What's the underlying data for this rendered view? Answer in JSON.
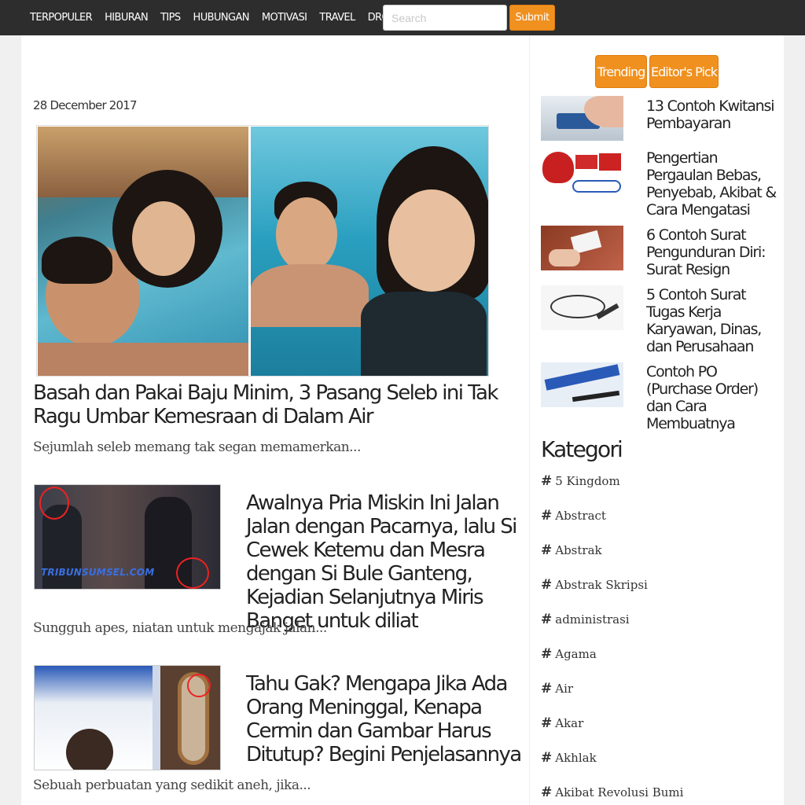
{
  "nav": {
    "items": [
      "TERPOPULER",
      "HIBURAN",
      "TIPS",
      "HUBUNGAN",
      "MOTIVASI",
      "TRAVEL",
      "DROPDOWN"
    ],
    "search_placeholder": "Search",
    "submit_label": "Submit",
    "caret_icon": "caret-down-icon"
  },
  "main": {
    "date": "28 December 2017",
    "hero": {
      "title": "Basah dan Pakai Baju Minim, 3 Pasang Seleb ini Tak Ragu Umbar Kemesraan di Dalam Air",
      "excerpt": "Sejumlah seleb memang tak segan memamerkan..."
    },
    "articles": [
      {
        "title": "Awalnya Pria Miskin Ini Jalan Jalan dengan Pacarnya, lalu Si Cewek Ketemu dan Mesra dengan Si Bule Ganteng, Kejadian Selanjutnya Miris Banget untuk diliat",
        "excerpt": "Sungguh apes, niatan untuk mengajak jalan...",
        "watermark": "TRIBUNSUMSEL.COM"
      },
      {
        "title": "Tahu Gak? Mengapa Jika Ada Orang Meninggal, Kenapa Cermin dan Gambar Harus Ditutup? Begini Penjelasannya",
        "excerpt": "Sebuah perbuatan yang sedikit aneh, jika..."
      }
    ]
  },
  "sidebar": {
    "tabs": [
      "Trending",
      "Editor's Pick"
    ],
    "trending": [
      {
        "title": "13 Contoh Kwitansi Pembayaran"
      },
      {
        "title": "Pengertian Pergaulan Bebas, Penyebab, Akibat & Cara Mengatasi"
      },
      {
        "title": "6 Contoh Surat Pengunduran Diri: Surat Resign"
      },
      {
        "title": "5 Contoh Surat Tugas Kerja Karyawan, Dinas, dan Perusahaan"
      },
      {
        "title": "Contoh PO (Purchase Order) dan Cara Membuatnya"
      }
    ],
    "kategori_heading": "Kategori",
    "categories": [
      "5 Kingdom",
      "Abstract",
      "Abstrak",
      "Abstrak Skripsi",
      "administrasi",
      "Agama",
      "Air",
      "Akar",
      "Akhlak",
      "Akibat Revolusi Bumi"
    ]
  },
  "colors": {
    "accent": "#f0901e",
    "navbar": "#2d2d2d"
  }
}
